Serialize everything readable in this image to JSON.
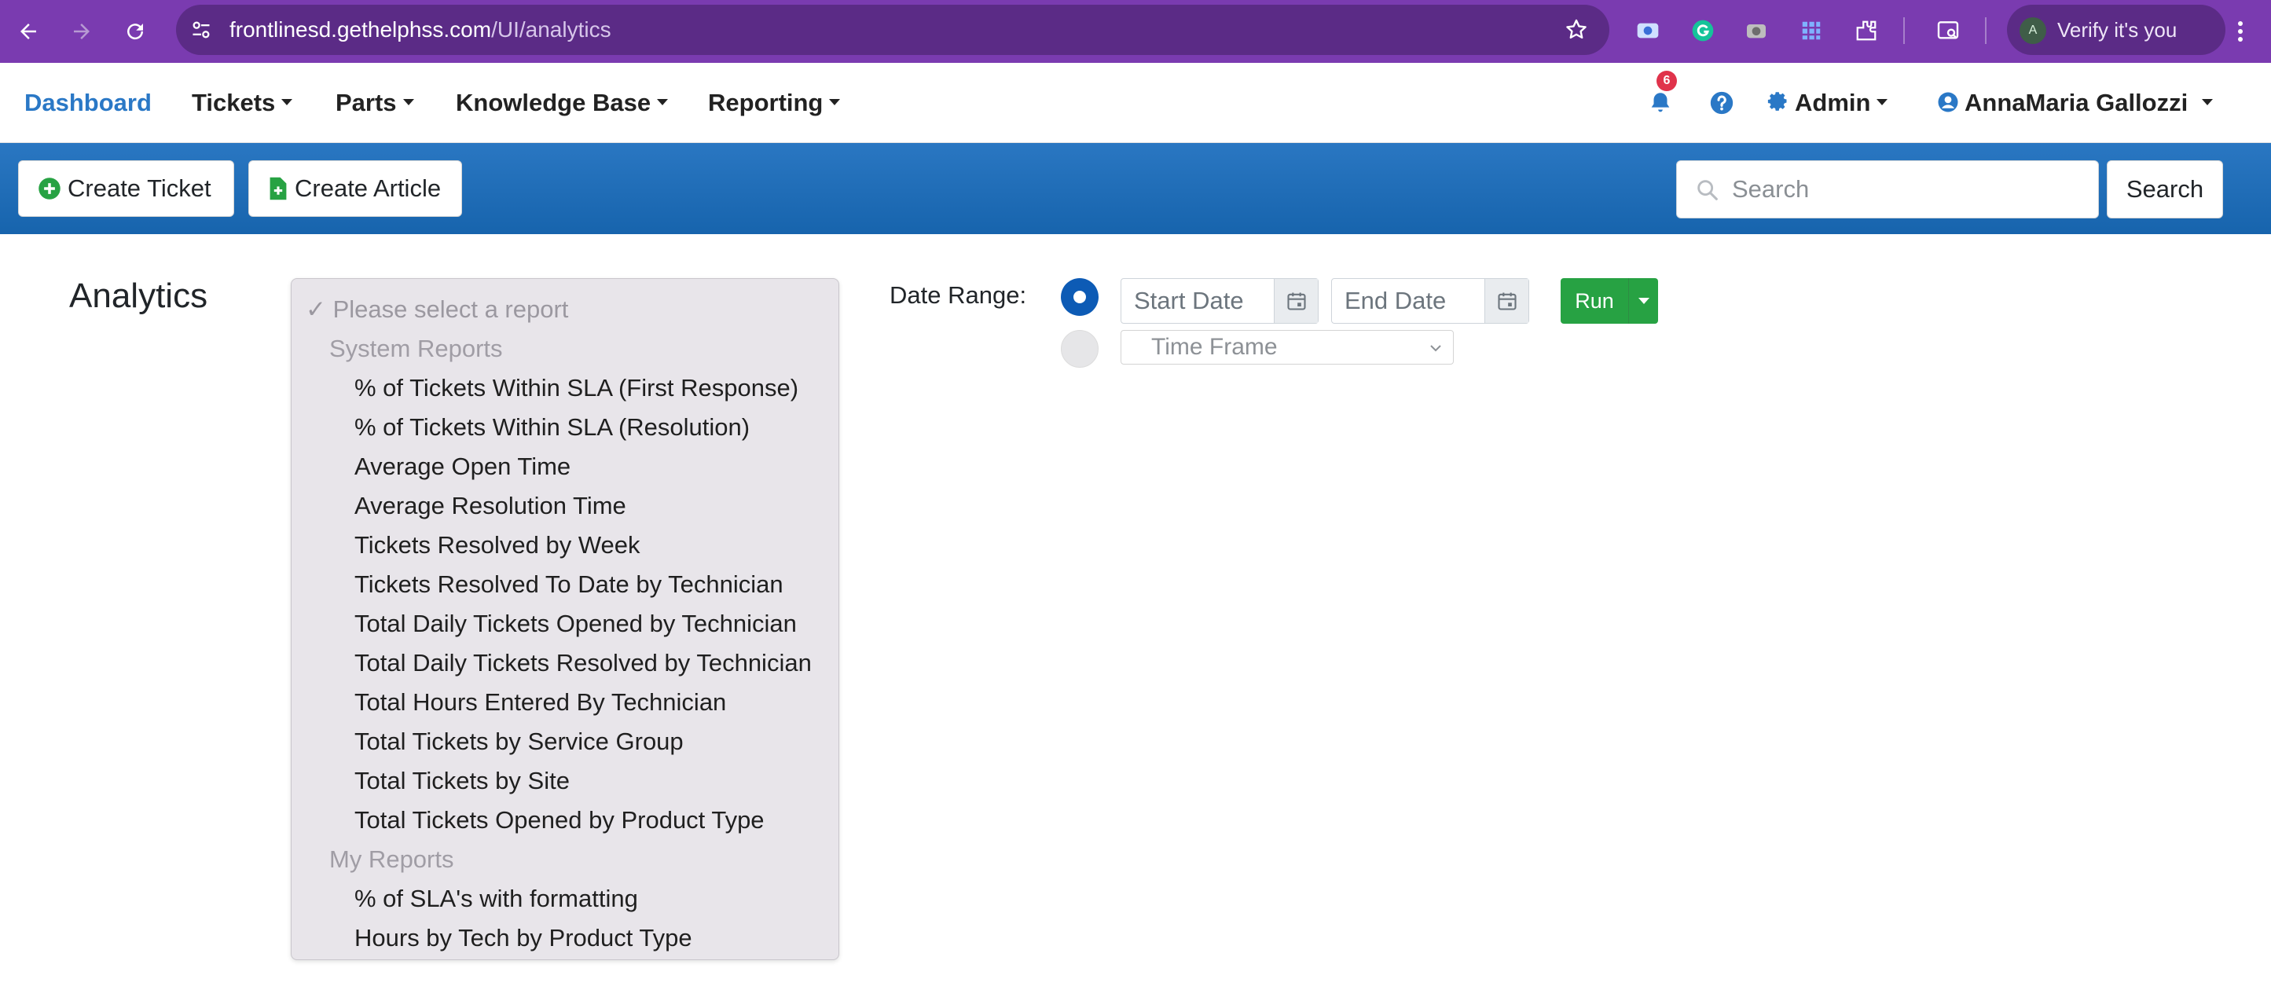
{
  "browser": {
    "url_host": "frontlinesd.gethelphss.com",
    "url_path": "/UI/analytics",
    "profile_initial": "A",
    "profile_label": "Verify it's you"
  },
  "nav": {
    "dashboard": "Dashboard",
    "tickets": "Tickets",
    "parts": "Parts",
    "knowledge_base": "Knowledge Base",
    "reporting": "Reporting",
    "notification_count": "6",
    "admin": "Admin",
    "user": "AnnaMaria Gallozzi"
  },
  "toolbar": {
    "create_ticket": "Create Ticket",
    "create_article": "Create Article",
    "search_placeholder": "Search",
    "search_button": "Search"
  },
  "page": {
    "title": "Analytics"
  },
  "reports": {
    "placeholder": "✓ Please select a report",
    "groups": [
      {
        "label": "System Reports",
        "items": [
          "% of Tickets Within SLA (First Response)",
          "% of Tickets Within SLA (Resolution)",
          "Average Open Time",
          "Average Resolution Time",
          "Tickets Resolved by Week",
          "Tickets Resolved To Date by Technician",
          "Total Daily Tickets Opened by Technician",
          "Total Daily Tickets Resolved by Technician",
          "Total Hours Entered By Technician",
          "Total Tickets by Service Group",
          "Total Tickets by Site",
          "Total Tickets Opened by Product Type"
        ]
      },
      {
        "label": "My Reports",
        "items": [
          "% of SLA's with formatting",
          "Hours by Tech by Product Type"
        ]
      }
    ]
  },
  "date_range": {
    "label": "Date Range:",
    "start_placeholder": "Start Date",
    "end_placeholder": "End Date",
    "time_frame": "Time Frame",
    "run": "Run"
  },
  "colors": {
    "browser_chrome": "#7a3bb0",
    "active_nav": "#2a78c6",
    "toolbar_blue": "#1f6db8",
    "run_green": "#27a243",
    "radio_selected": "#0d5bb5",
    "badge_red": "#e0334b"
  }
}
